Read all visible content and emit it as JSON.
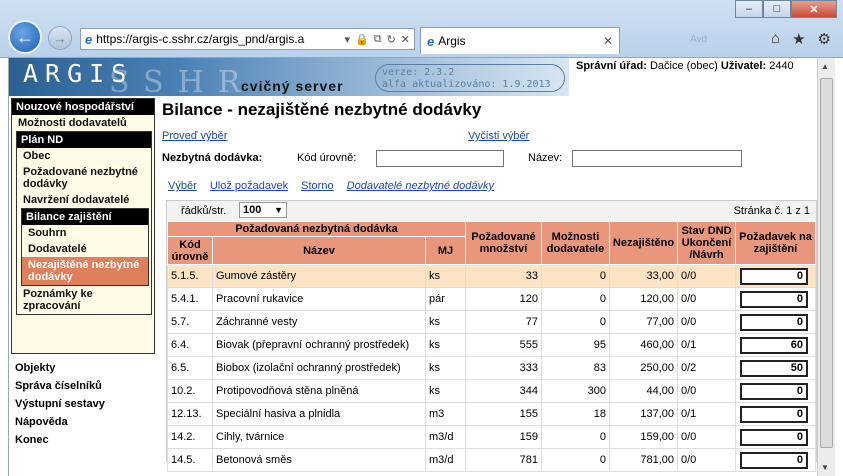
{
  "browser": {
    "url": "https://argis-c.sshr.cz/argis_pnd/argis.a",
    "tab_title": "Argis",
    "window_min": "–",
    "window_max": "□",
    "window_close": "✕",
    "ghost": "Avd"
  },
  "header": {
    "logo": "ARGIS",
    "logo_bg": "SSHR",
    "server": "cvičný server",
    "version": "verze: 2.3.2",
    "updated": "alfa aktualizováno: 1.9.2013",
    "office_label": "Správní úřad:",
    "office_value": "Dačice (obec)",
    "user_label": "Uživatel:",
    "user_value": "2440"
  },
  "sidebar": {
    "section1": "Nouzové hospodářství",
    "item_moznosti": "Možnosti dodavatelů",
    "section_plan": "Plán ND",
    "item_obec": "Obec",
    "item_pozadovane": "Požadované nezbytné dodávky",
    "item_navrzeni": "Navržení dodavatelé",
    "section_bilance": "Bilance zajištění",
    "item_souhrn": "Souhrn",
    "item_dodavatele": "Dodavatelé",
    "item_nezajistene": "Nezajištěné nezbytné dodávky",
    "item_poznamky": "Poznámky ke zpracování",
    "links": [
      "Objekty",
      "Správa číselníků",
      "Výstupní sestavy",
      "Nápověda",
      "Konec"
    ]
  },
  "main": {
    "title": "Bilance - nezajištěné nezbytné dodávky",
    "proved": "Proveď výběr",
    "vycisti": "Vyčisti výběr",
    "nd_label": "Nezbytná dodávka:",
    "kod_label": "Kód úrovně:",
    "kod_value": "",
    "nazev_label": "Název:",
    "nazev_value": "",
    "action_vyber": "Výběr",
    "action_uloz": "Ulož požadavek",
    "action_storno": "Storno",
    "action_dodavatele": "Dodavatelé nezbytné dodávky",
    "rows_label": "řádků/str.",
    "rows_value": "100",
    "page_info": "Stránka č. 1 z 1"
  },
  "table": {
    "group_header": "Požadovaná nezbytná dodávka",
    "headers": {
      "kod": "Kód úrovně",
      "nazev": "Název",
      "mj": "MJ",
      "pozadovane": "Požadované množství",
      "moznosti": "Možnosti dodavatele",
      "nezajisteno": "Nezajištěno",
      "stav": "Stav DND Ukončení /Návrh",
      "pozadavek": "Požadavek na zajištění"
    },
    "rows": [
      {
        "kod": "5.1.5.",
        "nazev": "Gumové zástěry",
        "mj": "ks",
        "poz": "33",
        "moz": "0",
        "nez": "33,00",
        "stav": "0/0",
        "req": "0"
      },
      {
        "kod": "5.4.1.",
        "nazev": "Pracovní rukavice",
        "mj": "pár",
        "poz": "120",
        "moz": "0",
        "nez": "120,00",
        "stav": "0/0",
        "req": "0"
      },
      {
        "kod": "5.7.",
        "nazev": "Záchranné vesty",
        "mj": "ks",
        "poz": "77",
        "moz": "0",
        "nez": "77,00",
        "stav": "0/0",
        "req": "0"
      },
      {
        "kod": "6.4.",
        "nazev": "Biovak (přepravní ochranný prostředek)",
        "mj": "ks",
        "poz": "555",
        "moz": "95",
        "nez": "460,00",
        "stav": "0/1",
        "req": "60"
      },
      {
        "kod": "6.5.",
        "nazev": "Biobox (izolační ochranný prostředek)",
        "mj": "ks",
        "poz": "333",
        "moz": "83",
        "nez": "250,00",
        "stav": "0/2",
        "req": "50"
      },
      {
        "kod": "10.2.",
        "nazev": "Protipovodňová stěna plněná",
        "mj": "ks",
        "poz": "344",
        "moz": "300",
        "nez": "44,00",
        "stav": "0/0",
        "req": "0"
      },
      {
        "kod": "12.13.",
        "nazev": "Speciální hasiva a plnidla",
        "mj": "m3",
        "poz": "155",
        "moz": "18",
        "nez": "137,00",
        "stav": "0/1",
        "req": "0"
      },
      {
        "kod": "14.2.",
        "nazev": "Cihly, tvárnice",
        "mj": "m3/d",
        "poz": "159",
        "moz": "0",
        "nez": "159,00",
        "stav": "0/0",
        "req": "0"
      },
      {
        "kod": "14.5.",
        "nazev": "Betonová směs",
        "mj": "m3/d",
        "poz": "781",
        "moz": "0",
        "nez": "781,00",
        "stav": "0/0",
        "req": "0"
      }
    ]
  }
}
